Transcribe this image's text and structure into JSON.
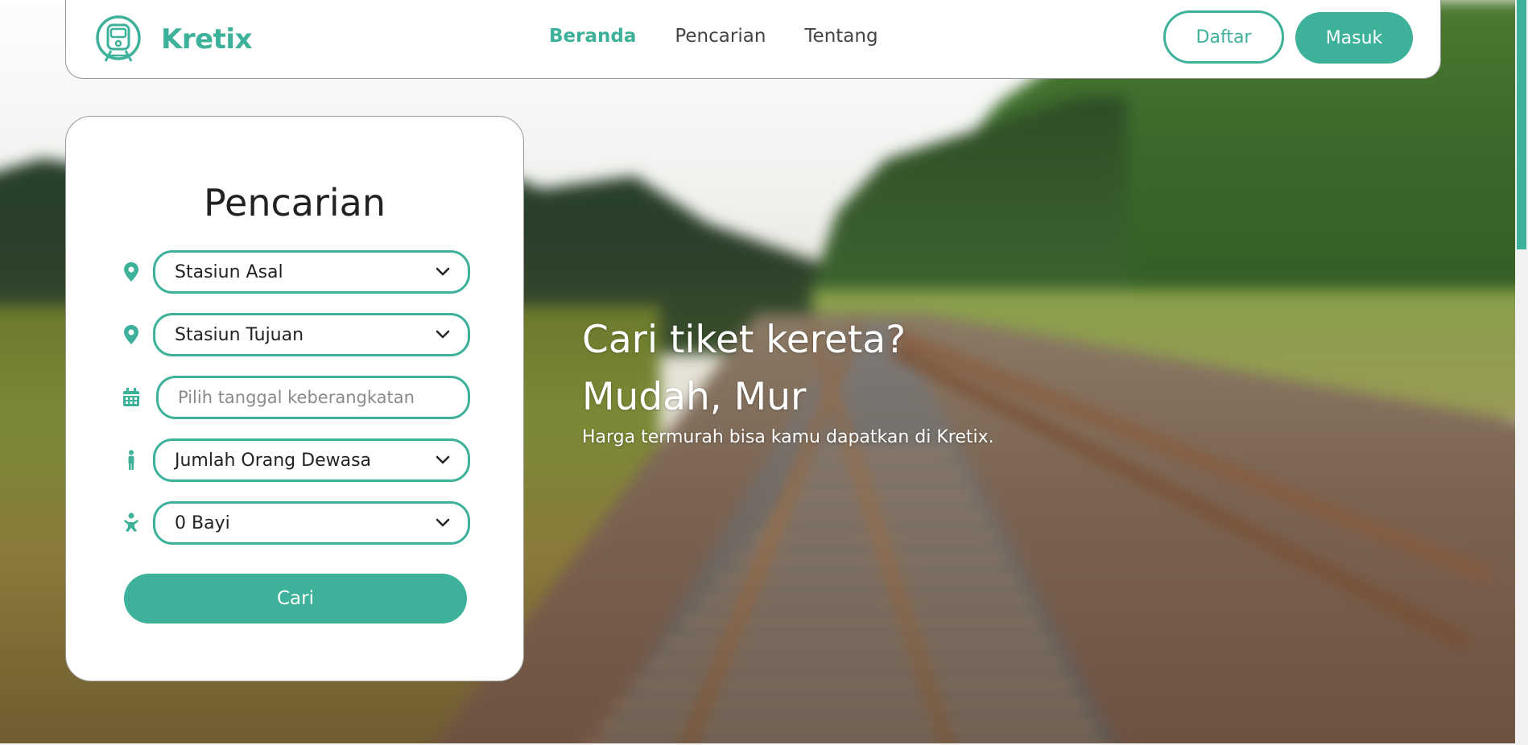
{
  "theme": {
    "accent": "#3eb19b",
    "text": "#222222",
    "nav_text": "#444444"
  },
  "navbar": {
    "brand_name": "Kretix",
    "logo_icon": "train-icon",
    "links": [
      {
        "label": "Beranda",
        "active": true
      },
      {
        "label": "Pencarian",
        "active": false
      },
      {
        "label": "Tentang",
        "active": false
      }
    ],
    "register_label": "Daftar",
    "login_label": "Masuk"
  },
  "search": {
    "title": "Pencarian",
    "origin": {
      "icon": "map-pin-icon",
      "value": "Stasiun Asal"
    },
    "destination": {
      "icon": "map-pin-icon",
      "value": "Stasiun Tujuan"
    },
    "date": {
      "icon": "calendar-icon",
      "placeholder": "Pilih tanggal keberangkatan",
      "value": ""
    },
    "adults": {
      "icon": "person-icon",
      "value": "Jumlah Orang Dewasa"
    },
    "infants": {
      "icon": "baby-icon",
      "value": "0 Bayi"
    },
    "submit_label": "Cari"
  },
  "hero": {
    "line1": "Cari tiket kereta?",
    "line2": "Mudah, Mur",
    "subtitle": "Harga termurah bisa kamu dapatkan di Kretix."
  }
}
